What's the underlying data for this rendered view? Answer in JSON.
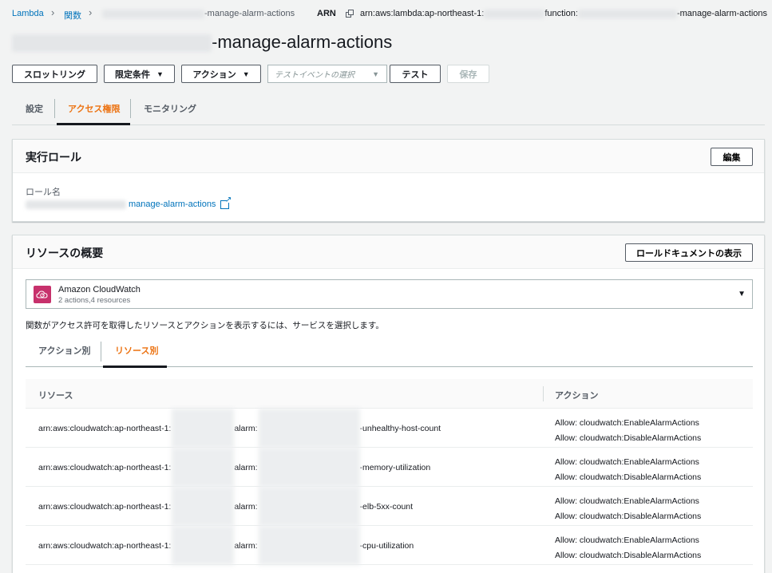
{
  "breadcrumb": {
    "root": "Lambda",
    "functions": "関数",
    "current_suffix": "-manage-alarm-actions"
  },
  "arn": {
    "label": "ARN",
    "prefix": "arn:aws:lambda:ap-northeast-1:",
    "middle": "function:",
    "suffix": "-manage-alarm-actions"
  },
  "title": {
    "suffix": "-manage-alarm-actions"
  },
  "toolbar": {
    "throttle": "スロットリング",
    "qualifiers": "限定条件",
    "actions": "アクション",
    "test_event_placeholder": "テストイベントの選択",
    "test": "テスト",
    "save": "保存"
  },
  "tabs": [
    {
      "label": "設定"
    },
    {
      "label": "アクセス権限"
    },
    {
      "label": "モニタリング"
    }
  ],
  "execution_role": {
    "title": "実行ロール",
    "edit": "編集",
    "role_name_label": "ロール名",
    "role_name_suffix": "manage-alarm-actions"
  },
  "resource_summary": {
    "title": "リソースの概要",
    "view_doc_button": "ロールドキュメントの表示",
    "service_name": "Amazon CloudWatch",
    "service_sub": "2 actions,4 resources",
    "description": "関数がアクセス許可を取得したリソースとアクションを表示するには、サービスを選択します。",
    "subtabs": [
      "アクション別",
      "リソース別"
    ],
    "columns": {
      "resource": "リソース",
      "action": "アクション"
    },
    "rows": [
      {
        "prefix": "arn:aws:cloudwatch:ap-northeast-1:",
        "alarm": "alarm:",
        "suffix": "-unhealthy-host-count",
        "actions": [
          "Allow: cloudwatch:EnableAlarmActions",
          "Allow: cloudwatch:DisableAlarmActions"
        ]
      },
      {
        "prefix": "arn:aws:cloudwatch:ap-northeast-1:",
        "alarm": "alarm:",
        "suffix": "-memory-utilization",
        "actions": [
          "Allow: cloudwatch:EnableAlarmActions",
          "Allow: cloudwatch:DisableAlarmActions"
        ]
      },
      {
        "prefix": "arn:aws:cloudwatch:ap-northeast-1:",
        "alarm": "alarm:",
        "suffix": "-elb-5xx-count",
        "actions": [
          "Allow: cloudwatch:EnableAlarmActions",
          "Allow: cloudwatch:DisableAlarmActions"
        ]
      },
      {
        "prefix": "arn:aws:cloudwatch:ap-northeast-1:",
        "alarm": "alarm:",
        "suffix": "-cpu-utilization",
        "actions": [
          "Allow: cloudwatch:EnableAlarmActions",
          "Allow: cloudwatch:DisableAlarmActions"
        ]
      }
    ]
  },
  "colors": {
    "accent": "#ec7211",
    "link": "#0073bb",
    "cloudwatch": "#c7316c"
  }
}
